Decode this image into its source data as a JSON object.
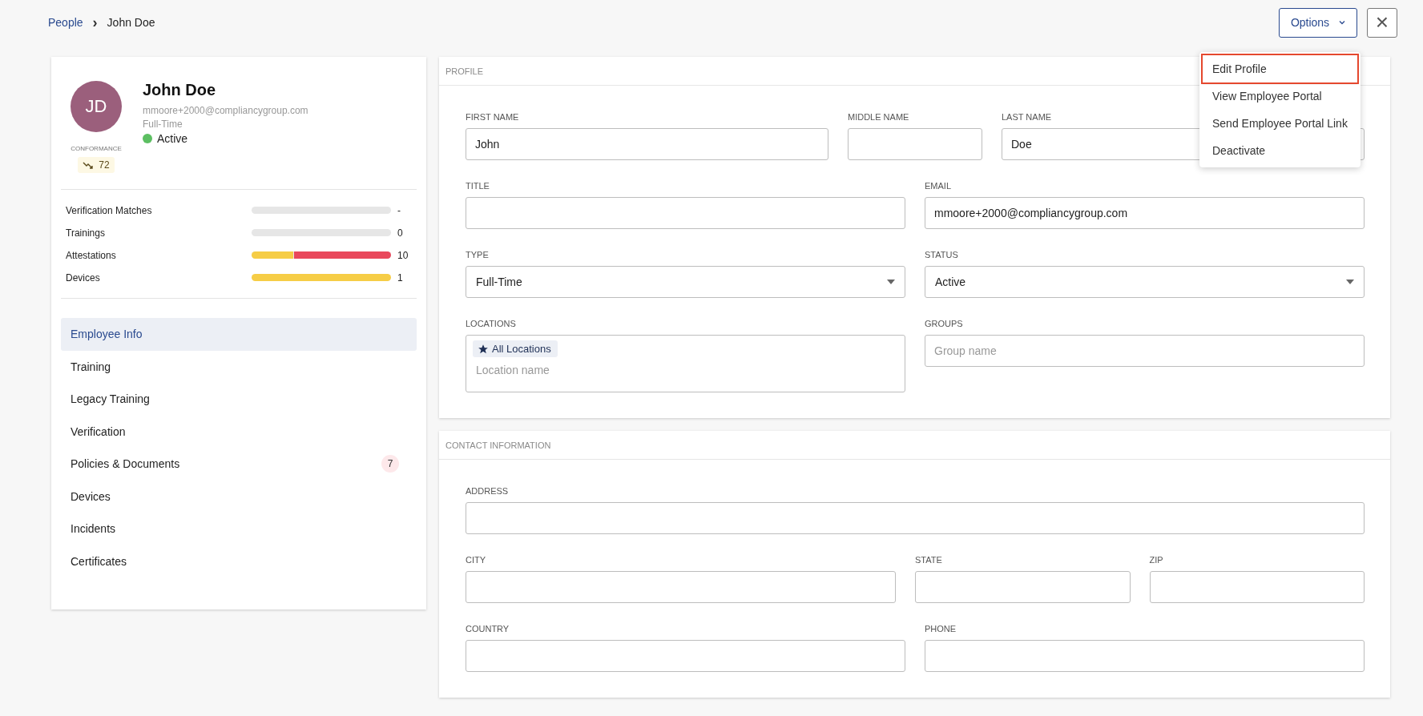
{
  "breadcrumb": {
    "parent": "People",
    "separator": "›",
    "current": "John Doe"
  },
  "options_button": {
    "label": "Options"
  },
  "close_button": {
    "label": "×"
  },
  "options_menu": [
    {
      "label": "Edit Profile",
      "selected": true
    },
    {
      "label": "View Employee Portal",
      "selected": false
    },
    {
      "label": "Send Employee Portal Link",
      "selected": false
    },
    {
      "label": "Deactivate",
      "selected": false
    }
  ],
  "person": {
    "initials": "JD",
    "name": "John Doe",
    "email": "mmoore+2000@compliancygroup.com",
    "type": "Full-Time",
    "status": "Active",
    "conformance_label": "CONFORMANCE",
    "conformance": "72"
  },
  "stats": [
    {
      "label": "Verification Matches",
      "value": "-"
    },
    {
      "label": "Trainings",
      "value": "0"
    },
    {
      "label": "Attestations",
      "value": "10",
      "segments": [
        {
          "level": 0.3,
          "color": "#f6cd46"
        },
        {
          "level": 0.7,
          "color": "#e9485c"
        }
      ]
    },
    {
      "label": "Devices",
      "value": "1",
      "segments": [
        {
          "level": 1,
          "color": "#f6cd46"
        }
      ]
    }
  ],
  "nav": [
    {
      "label": "Employee Info",
      "selected": true
    },
    {
      "label": "Training",
      "selected": false
    },
    {
      "label": "Legacy Training",
      "selected": false
    },
    {
      "label": "Verification",
      "selected": false
    },
    {
      "label": "Policies & Documents",
      "selected": false,
      "badge": "7"
    },
    {
      "label": "Devices",
      "selected": false
    },
    {
      "label": "Incidents",
      "selected": false
    },
    {
      "label": "Certificates",
      "selected": false
    }
  ],
  "sections": [
    {
      "title": "PROFILE",
      "rows": [
        [
          {
            "label": "FIRST NAME",
            "kind": "text",
            "value": "John"
          },
          {
            "label": "MIDDLE NAME",
            "kind": "text"
          },
          {
            "label": "LAST NAME",
            "kind": "text",
            "value": "Doe"
          }
        ],
        [
          {
            "label": "TITLE",
            "kind": "text"
          },
          {
            "label": "EMAIL",
            "kind": "text",
            "value": "mmoore+2000@compliancygroup.com"
          }
        ],
        [
          {
            "label": "TYPE",
            "kind": "select",
            "value": "Full-Time"
          },
          {
            "label": "STATUS",
            "kind": "select",
            "value": "Active"
          }
        ],
        [
          {
            "label": "LOCATIONS",
            "kind": "tags",
            "tags": [
              "All Locations"
            ],
            "placeholder": "Location name"
          },
          {
            "label": "GROUPS",
            "kind": "text",
            "placeholder": "Group name"
          }
        ]
      ]
    },
    {
      "title": "CONTACT INFORMATION",
      "rows": [
        [
          {
            "label": "ADDRESS",
            "kind": "text"
          }
        ],
        [
          {
            "label": "CITY",
            "kind": "text"
          },
          {
            "label": "STATE",
            "kind": "text"
          },
          {
            "label": "ZIP",
            "kind": "text"
          }
        ],
        [
          {
            "label": "COUNTRY",
            "kind": "text"
          },
          {
            "label": "PHONE",
            "kind": "text"
          }
        ]
      ]
    }
  ]
}
